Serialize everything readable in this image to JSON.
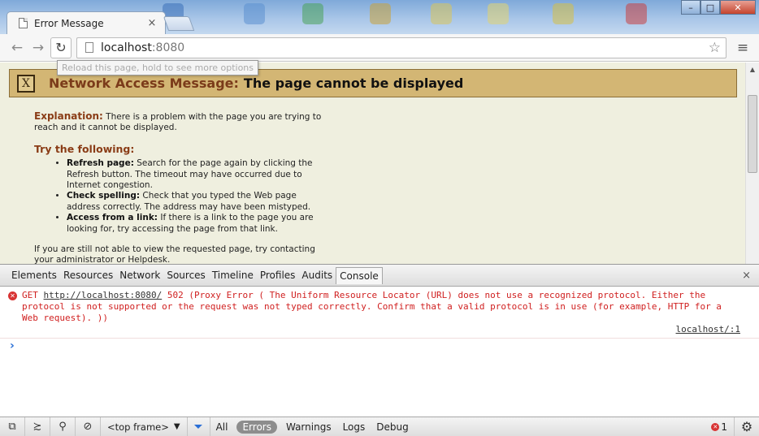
{
  "window": {
    "tab_title": "Error Message",
    "tab_close": "×",
    "controls": {
      "minimize": "–",
      "maximize": "□",
      "close": "✕"
    }
  },
  "toolbar": {
    "back_icon": "←",
    "forward_icon": "→",
    "reload_icon": "↻",
    "url_host": "localhost",
    "url_port": ":8080",
    "star_icon": "☆",
    "menu_icon": "≡",
    "tooltip": "Reload this page, hold to see more options"
  },
  "page": {
    "banner_close": "X",
    "banner_lead": "Network Access Message:",
    "banner_message": "The page cannot be displayed",
    "explanation_heading": "Explanation:",
    "explanation_text": "There is a problem with the page you are trying to reach and it cannot be displayed.",
    "try_heading": "Try the following:",
    "tips": [
      {
        "title": "Refresh page:",
        "text": "Search for the page again by clicking the Refresh button. The timeout may have occurred due to Internet congestion."
      },
      {
        "title": "Check spelling:",
        "text": "Check that you typed the Web page address correctly. The address may have been mistyped."
      },
      {
        "title": "Access from a link:",
        "text": "If there is a link to the page you are looking for, try accessing the page from that link."
      }
    ],
    "after_text": "If you are still not able to view the requested page, try contacting your administrator or Helpdesk."
  },
  "devtools": {
    "tabs": [
      "Elements",
      "Resources",
      "Network",
      "Sources",
      "Timeline",
      "Profiles",
      "Audits",
      "Console"
    ],
    "active_tab": "Console",
    "close_icon": "×",
    "console_message": {
      "method": "GET",
      "url": "http://localhost:8080/",
      "text": "502 (Proxy Error ( The Uniform Resource Locator (URL) does not use a recognized protocol. Either the protocol is not supported or the request was not typed correctly. Confirm that a valid protocol is in use (for example, HTTP for a Web request).  ))",
      "source": "localhost/:1"
    },
    "prompt": "›",
    "status": {
      "frame": "<top frame>",
      "levels": [
        "All",
        "Errors",
        "Warnings",
        "Logs",
        "Debug"
      ],
      "active_level": "Errors",
      "error_count": "1"
    }
  },
  "colors": {
    "banner_bg": "#d3b674",
    "page_bg": "#efefdf",
    "heading": "#8a3c16",
    "console_error": "#d02020"
  }
}
